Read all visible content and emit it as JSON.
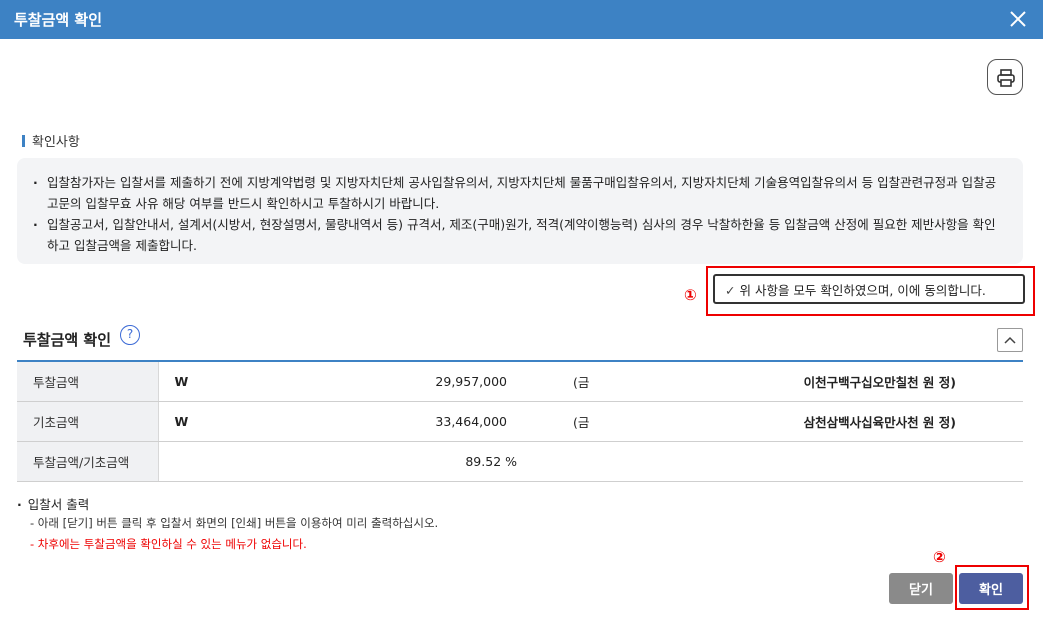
{
  "dialog": {
    "title": "투찰금액 확인",
    "close_icon": "close-icon"
  },
  "toolbar": {
    "print_icon": "printer-icon"
  },
  "notice": {
    "heading": "확인사항",
    "items": [
      "입찰참가자는 입찰서를 제출하기 전에 지방계약법령 및 지방자치단체 공사입찰유의서, 지방자치단체 물품구매입찰유의서, 지방자치단체 기술용역입찰유의서 등 입찰관련규정과 입찰공고문의 입찰무효 사유 해당 여부를 반드시 확인하시고 투찰하시기 바랍니다.",
      "입찰공고서, 입찰안내서, 설계서(시방서, 현장설명서, 물량내역서 등) 규격서, 제조(구매)원가, 적격(계약이행능력) 심사의 경우 낙찰하한율 등 입찰금액 산정에 필요한 제반사항을 확인하고 입찰금액을 제출합니다."
    ]
  },
  "agree": {
    "check_glyph": "✓",
    "label": "위 사항을 모두 확인하였으며, 이에 동의합니다.",
    "marker": "①"
  },
  "bid": {
    "title": "투찰금액 확인",
    "help_glyph": "?",
    "rows": [
      {
        "label": "투찰금액",
        "currency": "W",
        "amount": "29,957,000",
        "paren": "(금",
        "korean": "이천구백구십오만칠천  원 정)"
      },
      {
        "label": "기초금액",
        "currency": "W",
        "amount": "33,464,000",
        "paren": "(금",
        "korean": "삼천삼백사십육만사천  원 정)"
      },
      {
        "label": "투찰금액/기초금액",
        "ratio": "89.52  %"
      }
    ]
  },
  "output": {
    "heading": "입찰서 출력",
    "lines": [
      "- 아래 [닫기] 버튼 클릭 후 입찰서 화면의 [인쇄] 버튼을 이용하여 미리 출력하십시오.",
      "- 차후에는 투찰금액을 확인하실 수 있는 메뉴가 없습니다."
    ]
  },
  "buttons": {
    "close_label": "닫기",
    "confirm_label": "확인",
    "confirm_marker": "②"
  },
  "colors": {
    "titlebar": "#3d82c4",
    "highlight": "#ee0000",
    "confirm_button": "#4d5ea0",
    "close_button": "#8a8a8a"
  }
}
